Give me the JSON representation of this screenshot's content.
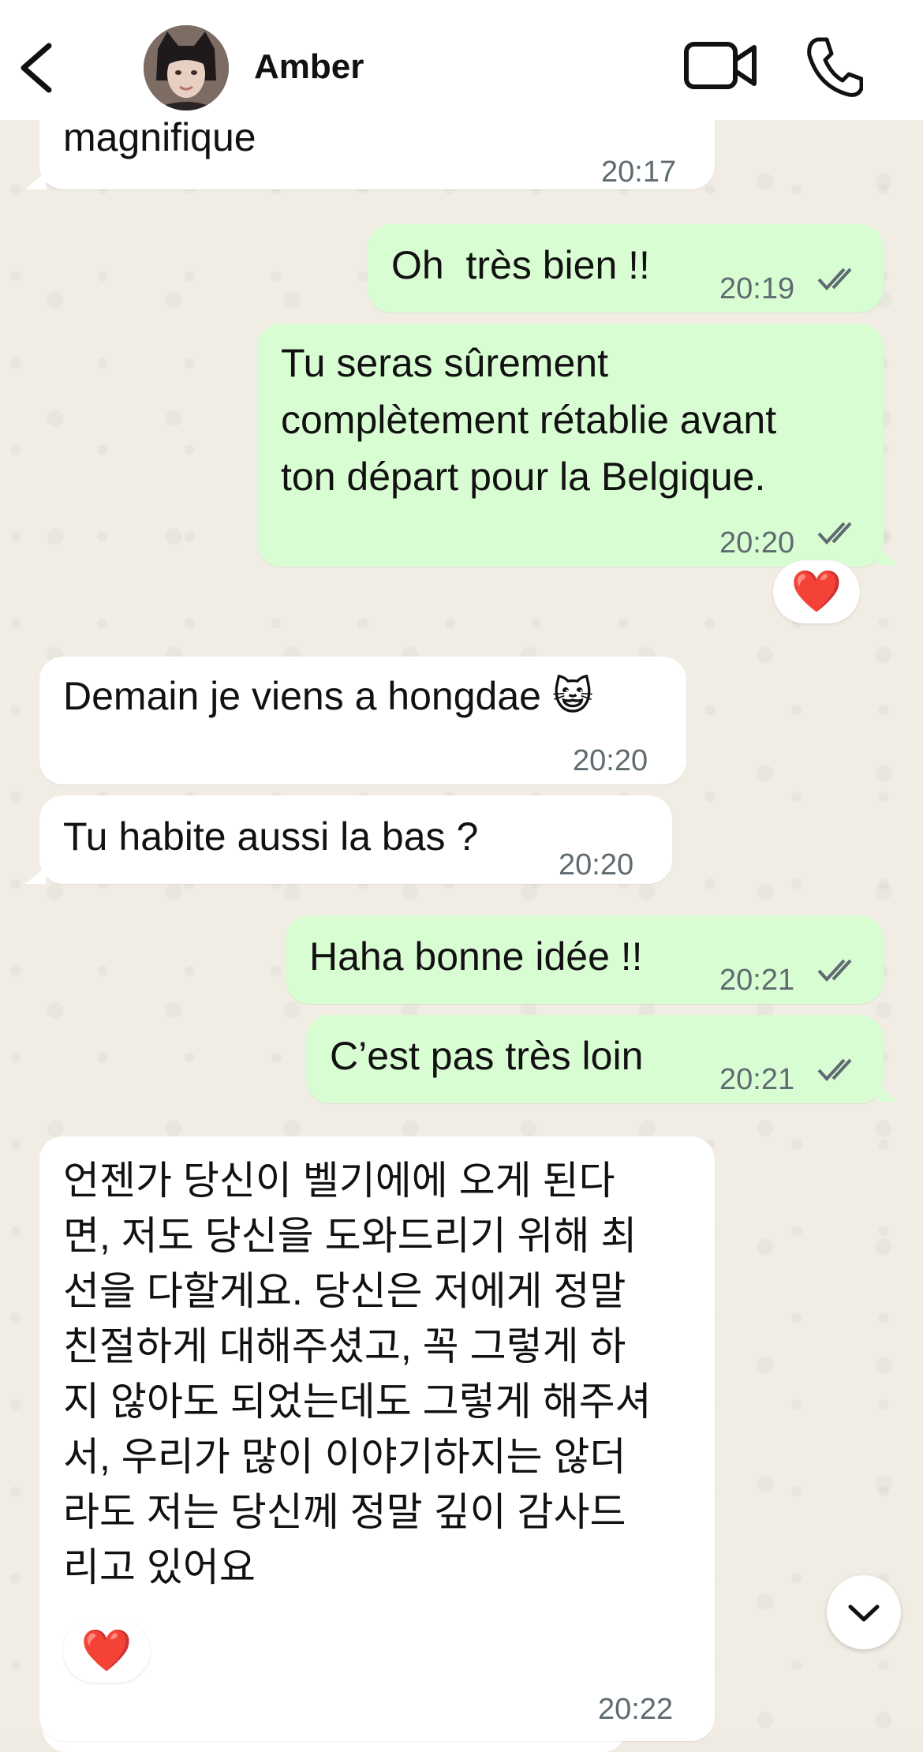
{
  "header": {
    "contact_name": "Amber",
    "back_icon": "chevron-left-icon",
    "video_icon": "video-camera-icon",
    "call_icon": "phone-icon"
  },
  "messages": [
    {
      "id": "m1",
      "direction": "incoming",
      "text": "magnifique",
      "time": "20:17"
    },
    {
      "id": "m2",
      "direction": "outgoing",
      "text": "Oh  très bien !!",
      "time": "20:19",
      "status": "read"
    },
    {
      "id": "m3",
      "direction": "outgoing",
      "lines": [
        "Tu seras sûrement",
        "complètement rétablie avant",
        "ton départ pour la Belgique."
      ],
      "time": "20:20",
      "status": "read",
      "reaction": "❤️"
    },
    {
      "id": "m4",
      "direction": "incoming",
      "text": "Demain je viens a hongdae 😺",
      "time": "20:20"
    },
    {
      "id": "m5",
      "direction": "incoming",
      "text": "Tu habite aussi la bas ?",
      "time": "20:20"
    },
    {
      "id": "m6",
      "direction": "outgoing",
      "text": "Haha bonne idée !!",
      "time": "20:21",
      "status": "read"
    },
    {
      "id": "m7",
      "direction": "outgoing",
      "text": "C’est pas très loin",
      "time": "20:21",
      "status": "read"
    },
    {
      "id": "m8",
      "direction": "incoming",
      "lines": [
        "언젠가 당신이 벨기에에 오게 된다",
        "면, 저도 당신을 도와드리기 위해 최",
        "선을 다할게요. 당신은 저에게 정말",
        "친절하게 대해주셨고, 꼭 그렇게 하",
        "지 않아도 되었는데도 그렇게 해주셔",
        "서, 우리가 많이 이야기하지는 않더",
        "라도 저는 당신께 정말 깊이 감사드",
        "리고 있어요"
      ],
      "time": "20:22",
      "reaction": "❤️"
    }
  ],
  "colors": {
    "incoming_bubble": "#ffffff",
    "outgoing_bubble": "#d9fdd3",
    "read_tick": "#5f6b70",
    "wallpaper": "#efeae2"
  }
}
